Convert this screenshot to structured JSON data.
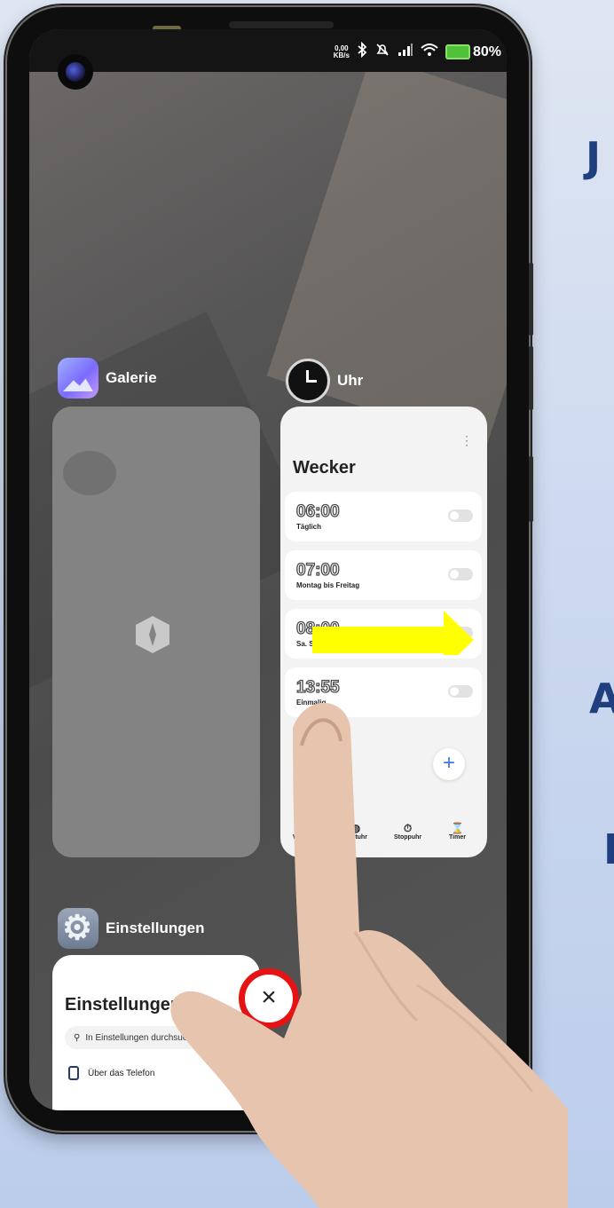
{
  "side_text": {
    "letter1": "J",
    "letter2": "A",
    "letter3": "E"
  },
  "status_bar": {
    "net_speed_value": "0,00",
    "net_speed_unit": "KB/s",
    "battery": "80%",
    "icons": [
      "bluetooth-icon",
      "mute-icon",
      "signal-icon",
      "wifi-icon",
      "battery-charging-icon"
    ]
  },
  "recents": {
    "gallery": {
      "label": "Galerie",
      "icon": "gallery-icon"
    },
    "clock": {
      "label": "Uhr",
      "icon": "clock-icon",
      "screen_title": "Wecker",
      "alarms": [
        {
          "time": "06:00",
          "repeat": "Täglich"
        },
        {
          "time": "07:00",
          "repeat": "Montag bis Freitag"
        },
        {
          "time": "08:00",
          "repeat": "Sa. So."
        },
        {
          "time": "13:55",
          "repeat": "Einmalig"
        }
      ],
      "add_symbol": "+",
      "nav_tabs": [
        "Wecker",
        "Weltuhr",
        "Stoppuhr",
        "Timer"
      ]
    },
    "settings": {
      "label": "Einstellungen",
      "icon": "settings-gear-icon",
      "screen_title": "Einstellungen",
      "search_placeholder": "In Einstellungen durchsuchen",
      "first_item": "Über das Telefon"
    }
  },
  "close_button": {
    "symbol": "×"
  },
  "annotations": {
    "arrow_color": "#ffff00",
    "close_ring_color": "#e51313"
  }
}
